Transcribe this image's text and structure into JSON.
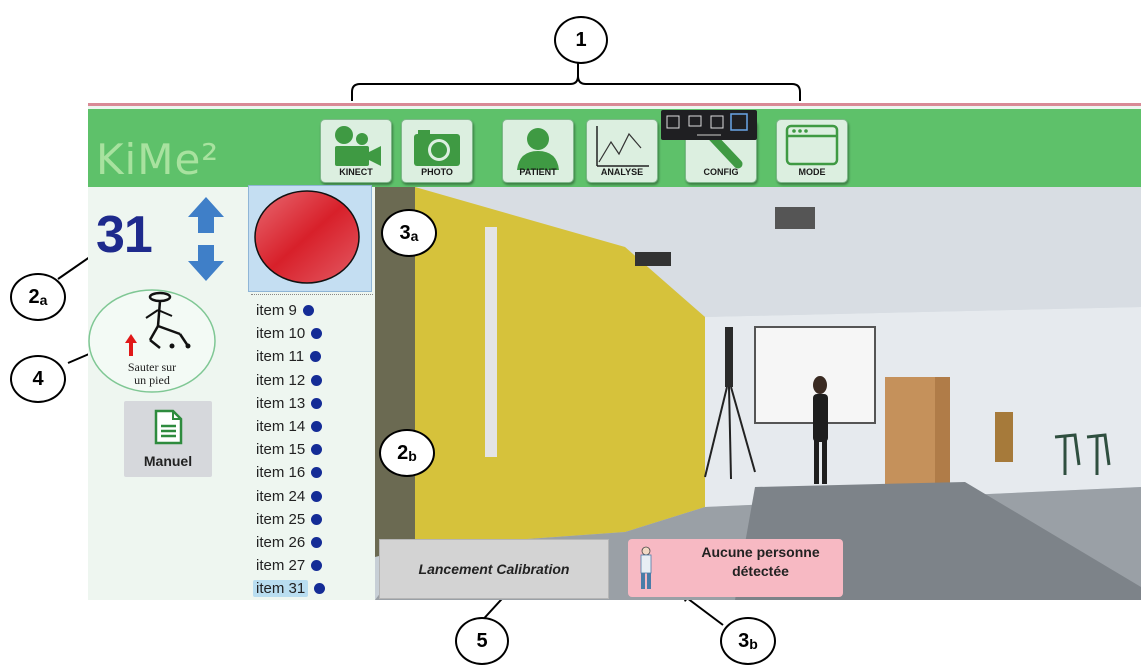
{
  "app": {
    "logo": "KiMe²",
    "toolbar": [
      {
        "id": "kinect",
        "label": "KINECT",
        "icon": "video-camera-icon"
      },
      {
        "id": "photo",
        "label": "PHOTO",
        "icon": "photo-camera-icon"
      },
      {
        "id": "patient",
        "label": "PATIENT",
        "icon": "person-icon"
      },
      {
        "id": "analyse",
        "label": "ANALYSE",
        "icon": "line-chart-icon"
      },
      {
        "id": "config",
        "label": "CONFIG",
        "icon": "wrench-icon"
      },
      {
        "id": "mode",
        "label": "MODE",
        "icon": "window-icon"
      }
    ],
    "item_count": "31",
    "exercise": {
      "label_line1": "Sauter sur",
      "label_line2": "un pied"
    },
    "manual_label": "Manuel",
    "items": [
      "item 9",
      "item 10",
      "item 11",
      "item 12",
      "item 13",
      "item 14",
      "item 15",
      "item 16",
      "item 24",
      "item 25",
      "item 26",
      "item 27",
      "item 31"
    ],
    "selected_item": "item 31",
    "calibration_button": "Lancement Calibration",
    "status": {
      "line1": "Aucune personne",
      "line2": "détectée",
      "color": "#f7b9c3"
    },
    "selection_indicator_color": "#d8202a",
    "accent_color": "#5ec16a"
  },
  "annotations": [
    {
      "id": "1",
      "num": "1",
      "sub": ""
    },
    {
      "id": "2a",
      "num": "2",
      "sub": "a"
    },
    {
      "id": "2b",
      "num": "2",
      "sub": "b"
    },
    {
      "id": "3a",
      "num": "3",
      "sub": "a"
    },
    {
      "id": "3b",
      "num": "3",
      "sub": "b"
    },
    {
      "id": "4",
      "num": "4",
      "sub": ""
    },
    {
      "id": "5",
      "num": "5",
      "sub": ""
    }
  ]
}
